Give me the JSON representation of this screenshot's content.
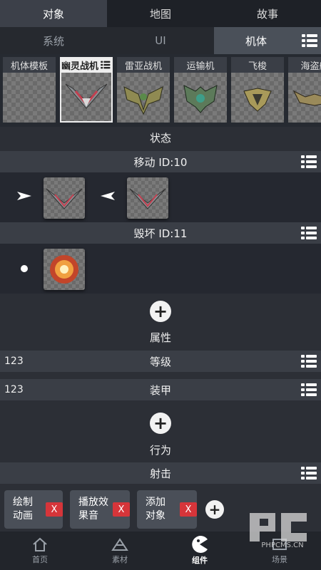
{
  "top_tabs": [
    {
      "label": "对象",
      "active": true
    },
    {
      "label": "地图",
      "active": false
    },
    {
      "label": "故事",
      "active": false
    }
  ],
  "sub_tabs": [
    {
      "label": "系统",
      "active": false
    },
    {
      "label": "UI",
      "active": false
    },
    {
      "label": "机体",
      "active": true
    }
  ],
  "gallery": [
    {
      "label": "机体模板",
      "selected": false,
      "icon": "empty-template"
    },
    {
      "label": "幽灵战机",
      "selected": true,
      "icon": "ghost-fighter-sprite"
    },
    {
      "label": "雷亚战机",
      "selected": false,
      "icon": "raya-fighter-sprite"
    },
    {
      "label": "运输机",
      "selected": false,
      "icon": "transport-sprite"
    },
    {
      "label": "飞梭",
      "selected": false,
      "icon": "shuttle-sprite"
    },
    {
      "label": "海盗船",
      "selected": false,
      "icon": "pirate-ship-sprite"
    }
  ],
  "section_status": {
    "label": "状态"
  },
  "state_move": {
    "label": "移动 ID:10"
  },
  "state_destroy": {
    "label": "毁坏 ID:11"
  },
  "section_attributes": {
    "label": "属性"
  },
  "attributes": [
    {
      "value": "123",
      "label": "等级"
    },
    {
      "value": "123",
      "label": "装甲"
    }
  ],
  "section_behavior": {
    "label": "行为"
  },
  "behavior_shoot": {
    "label": "射击"
  },
  "actions": [
    {
      "line1": "绘制",
      "line2": "动画",
      "remove": "X"
    },
    {
      "line1": "播放效",
      "line2": "果音",
      "remove": "X"
    },
    {
      "line1": "添加",
      "line2": "对象",
      "remove": "X"
    }
  ],
  "bottom_nav": [
    {
      "label": "首页",
      "icon": "home-icon",
      "active": false
    },
    {
      "label": "素材",
      "icon": "material-icon",
      "active": false
    },
    {
      "label": "组件",
      "icon": "component-icon",
      "active": true
    },
    {
      "label": "场景",
      "icon": "scene-icon",
      "active": false
    }
  ],
  "watermark": {
    "text": "PHPCMS.CN"
  },
  "colors": {
    "background": "#2c2f36",
    "remove_button": "#d6353a",
    "selected_tab": "#4a5059"
  }
}
